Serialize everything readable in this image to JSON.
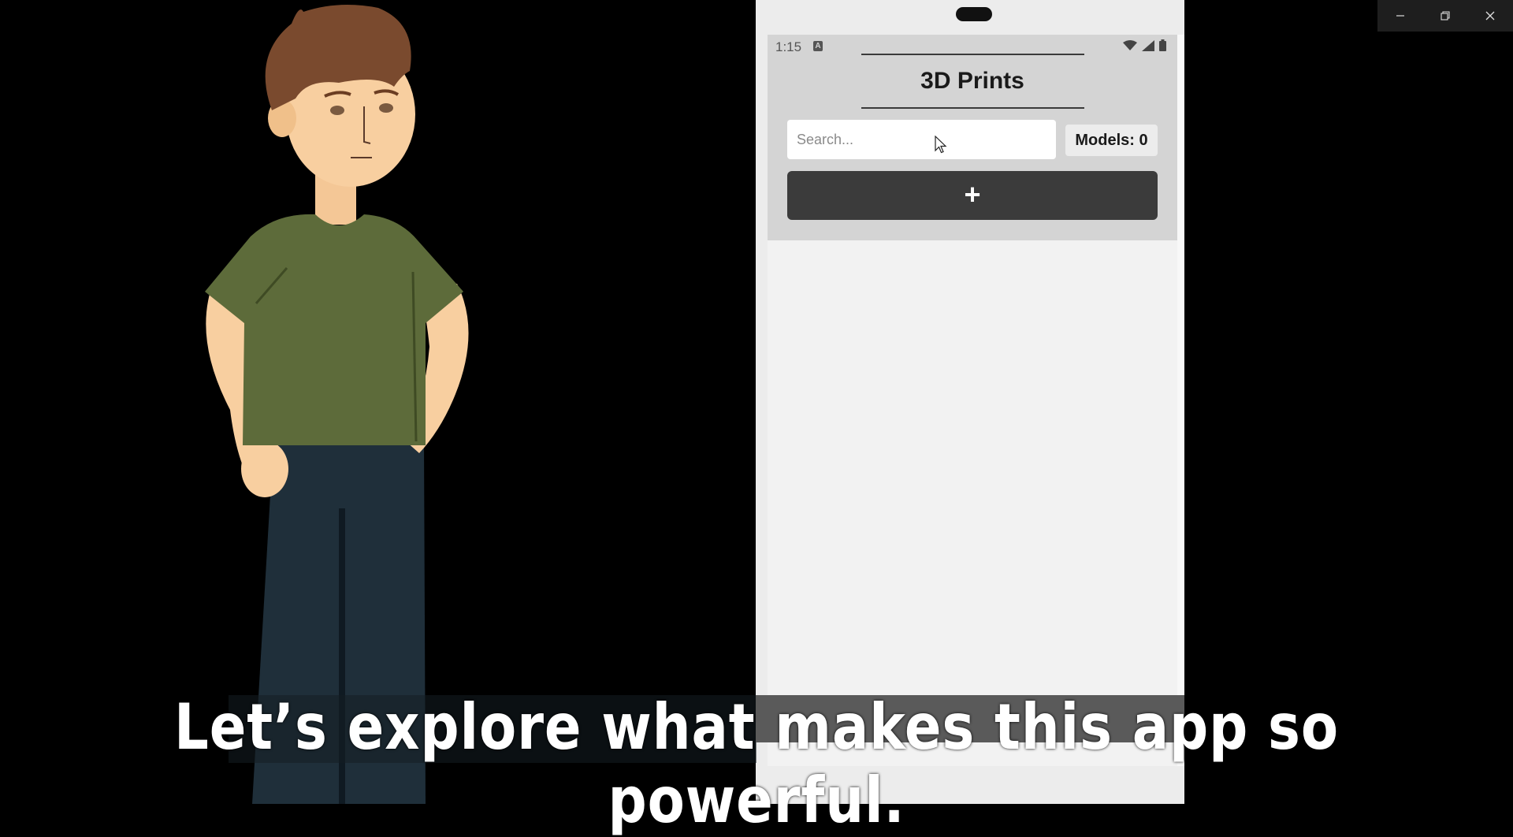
{
  "window": {
    "controls": [
      "minimize-icon",
      "restore-icon",
      "close-icon"
    ]
  },
  "phone": {
    "status_bar": {
      "time": "1:15",
      "indicator": "A",
      "icons": [
        "wifi-icon",
        "signal-icon",
        "battery-icon"
      ]
    },
    "app": {
      "title": "3D Prints",
      "search": {
        "placeholder": "Search...",
        "value": ""
      },
      "models_count_label": "Models: 0",
      "add_button_label": "+"
    }
  },
  "caption": "Let’s explore what makes this app so powerful.",
  "colors": {
    "appbar": "#d4d4d4",
    "add_button": "#3b3b3b",
    "screen_bg": "#f2f2f2",
    "shirt": "#5d6b3a",
    "pants": "#1f2f3a",
    "hair": "#7a4a2e",
    "skin": "#f8cfa0"
  }
}
